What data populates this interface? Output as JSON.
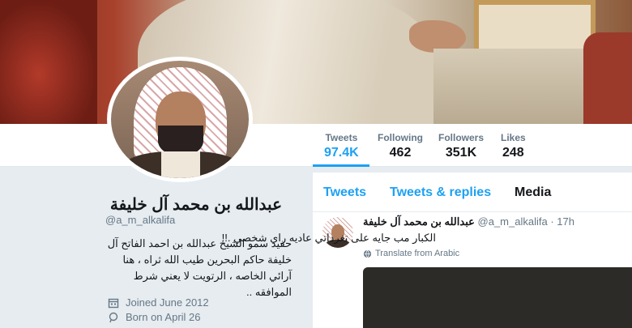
{
  "profile": {
    "name": "عبدالله بن محمد آل خليفة",
    "handle": "@a_m_alkalifa",
    "bio": "حفيد سمو الشيخ عبدالله بن احمد الفاتح آل خليفة حاكم البحرين طيب الله ثراه ، هنا آرائي الخاصه ، الرتويت لا يعني شرط الموافقه ..",
    "joined": "Joined June 2012",
    "born": "Born on April 26"
  },
  "stats": [
    {
      "label": "Tweets",
      "value": "97.4K",
      "active": true
    },
    {
      "label": "Following",
      "value": "462"
    },
    {
      "label": "Followers",
      "value": "351K"
    },
    {
      "label": "Likes",
      "value": "248"
    }
  ],
  "tabs": [
    {
      "label": "Tweets"
    },
    {
      "label": "Tweets & replies"
    },
    {
      "label": "Media",
      "active": true
    }
  ],
  "tweet": {
    "name": "عبدالله بن محمد آل خليفة",
    "handle": "@a_m_alkalifa",
    "time": "· 17h",
    "text": "الكبار مب جايه على تغرداتي عاديه راي شخصي .!!",
    "translate": "Translate from Arabic"
  },
  "colors": {
    "accent": "#1da1f2",
    "text": "#14171a",
    "muted": "#657786",
    "background": "#e6ecf0"
  },
  "icons": [
    "calendar-icon",
    "location-pin-icon",
    "globe-icon"
  ]
}
